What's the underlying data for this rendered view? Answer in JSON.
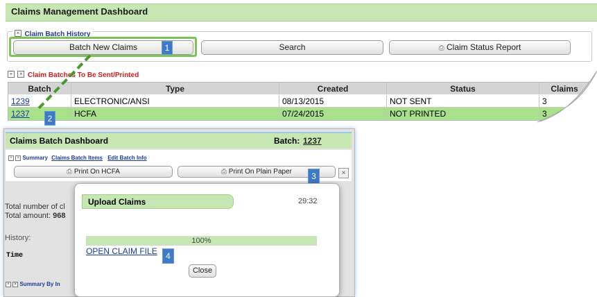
{
  "header": {
    "title": "Claims Management Dashboard"
  },
  "history_section": {
    "legend": "Claim Batch History",
    "buttons": {
      "batch_new": "Batch New Claims",
      "search": "Search",
      "status_report": "Claim Status Report"
    }
  },
  "batches_section": {
    "legend": "Claim Batches To Be Sent/Printed",
    "columns": [
      "Batch",
      "Type",
      "Created",
      "Status",
      "Claims"
    ],
    "rows": [
      {
        "batch": "1239",
        "type": "ELECTRONIC/ANSI",
        "created": "08/13/2015",
        "status": "NOT SENT",
        "claims": "3"
      },
      {
        "batch": "1237",
        "type": "HCFA",
        "created": "07/24/2015",
        "status": "NOT PRINTED",
        "claims": "3"
      }
    ]
  },
  "batch_dashboard": {
    "title": "Claims Batch Dashboard",
    "batch_label": "Batch:",
    "batch_number": "1237",
    "summary": "Summary",
    "claims_batch_items": "Claims Batch Items",
    "edit_batch_info": "Edit Batch Info",
    "print_hcfa": "Print On HCFA",
    "print_plain": "Print On Plain Paper",
    "total_claims": "Total number of cl",
    "total_amount_label": "Total amount:",
    "total_amount_value": "968",
    "history": "History:",
    "time": "Time",
    "summary_by": "Summary By In"
  },
  "upload_dialog": {
    "title": "Upload Claims",
    "time": "29:32",
    "progress_text": "100%",
    "progress": 1.0,
    "open_file": "OPEN CLAIM FILE",
    "close": "Close"
  },
  "callouts": [
    "1",
    "2",
    "3",
    "4"
  ],
  "colors": {
    "accent_green": "#c6e7b2",
    "row_green": "#a9e08b",
    "callout_blue": "#3e7ac6",
    "link_blue": "#1a3aa8",
    "dash_green": "#4a9a2a"
  }
}
